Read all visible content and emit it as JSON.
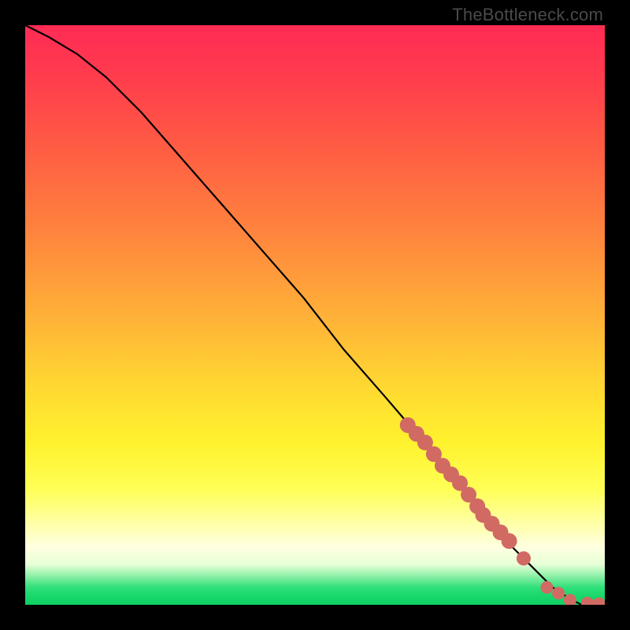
{
  "watermark": "TheBottleneck.com",
  "colors": {
    "curve": "#000000",
    "marker_fill": "#d16a63",
    "marker_stroke": "#b85850"
  },
  "chart_data": {
    "type": "line",
    "title": "",
    "xlabel": "",
    "ylabel": "",
    "xlim": [
      0,
      100
    ],
    "ylim": [
      0,
      100
    ],
    "grid": false,
    "legend": false,
    "curve": {
      "x": [
        0,
        4,
        9,
        14,
        20,
        27,
        34,
        41,
        48,
        55,
        62,
        68,
        74,
        80,
        84,
        88,
        91,
        94,
        96,
        98,
        100
      ],
      "y": [
        100,
        98,
        95,
        91,
        85,
        77,
        69,
        61,
        53,
        44,
        36,
        29,
        22,
        15,
        10,
        6,
        3,
        1,
        0,
        0,
        0
      ]
    },
    "markers": {
      "comment": "Highlighted dot cluster along lower-right tail of the curve",
      "x": [
        66,
        67.5,
        69,
        70.5,
        72,
        73.5,
        75,
        76.5,
        78,
        79,
        80.5,
        82,
        83.5,
        86,
        90,
        92,
        94,
        97,
        99
      ],
      "y": [
        31,
        29.5,
        28,
        26,
        24,
        22.5,
        21,
        19,
        17,
        15.5,
        14,
        12.5,
        11,
        8,
        3,
        2,
        0.8,
        0.3,
        0.2
      ],
      "r": [
        10,
        10,
        10,
        10,
        10,
        10,
        10,
        10,
        10,
        10,
        10,
        10,
        10,
        9,
        8,
        8,
        8,
        8,
        8
      ]
    }
  }
}
